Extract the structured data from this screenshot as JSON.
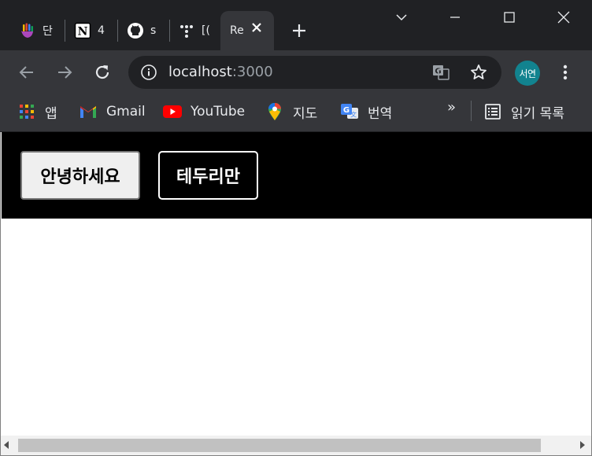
{
  "tabs": [
    {
      "title": "단",
      "icon": "hand-logo-icon"
    },
    {
      "title": "4",
      "icon": "notion-icon"
    },
    {
      "title": "s",
      "icon": "github-icon"
    },
    {
      "title": "[(",
      "icon": "dots-grid-icon"
    },
    {
      "title": "Re",
      "icon": "none",
      "active": true
    }
  ],
  "address_bar": {
    "host": "localhost",
    "port": ":3000"
  },
  "profile": {
    "initials": "서연",
    "color": "#12838f"
  },
  "bookmarks": [
    {
      "label": "앱",
      "icon": "apps-grid-icon"
    },
    {
      "label": "Gmail",
      "icon": "gmail-icon"
    },
    {
      "label": "YouTube",
      "icon": "youtube-icon"
    },
    {
      "label": "지도",
      "icon": "maps-pin-icon"
    },
    {
      "label": "번역",
      "icon": "translate-icon"
    }
  ],
  "bookmarks_overflow": "»",
  "reading_list": {
    "label": "읽기 목록",
    "icon": "reading-list-icon"
  },
  "page": {
    "background_band_color": "#000000",
    "button_default": {
      "label": "안녕하세요"
    },
    "button_outlined": {
      "label": "테두리만"
    }
  }
}
